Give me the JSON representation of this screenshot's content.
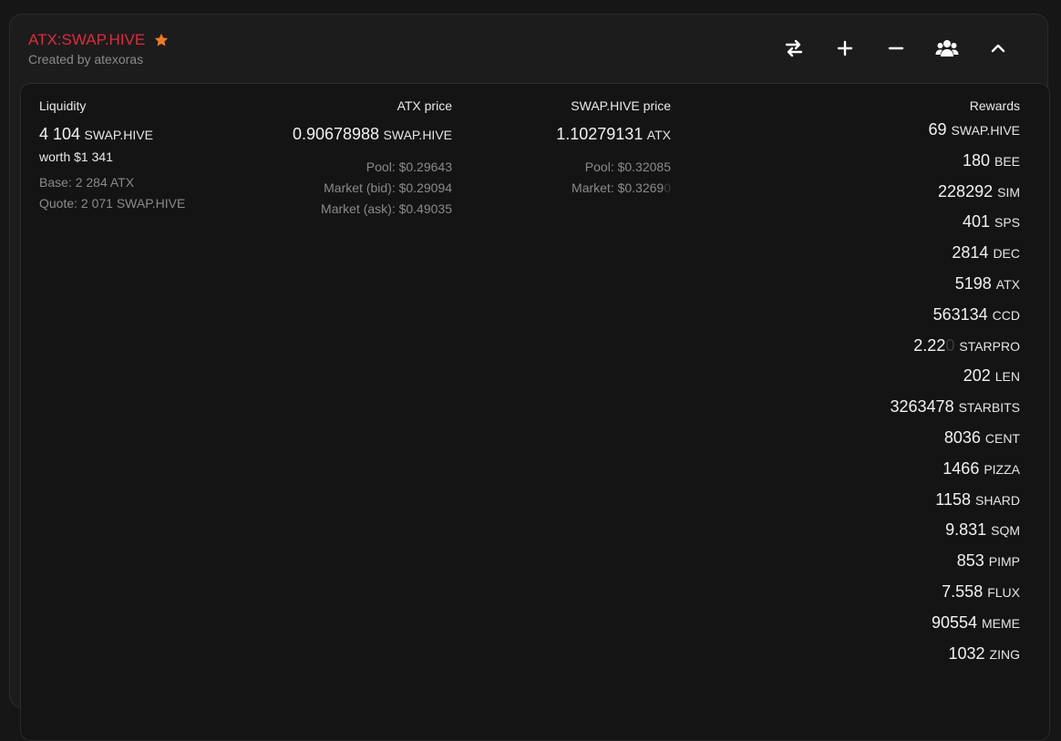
{
  "header": {
    "title": "ATX:SWAP.HIVE",
    "subtitle": "Created by atexoras"
  },
  "actions": [
    {
      "icon": "swap-arrows-icon"
    },
    {
      "icon": "plus-icon"
    },
    {
      "icon": "minus-icon"
    },
    {
      "icon": "users-icon"
    },
    {
      "icon": "chevron-up-icon"
    }
  ],
  "colors": {
    "accent": "#e02a3e",
    "star": "#f07c22"
  },
  "liquidity": {
    "label": "Liquidity",
    "amount": "4 104",
    "unit": "SWAP.HIVE",
    "worth": "worth $1 341",
    "base": "Base: 2 284 ATX",
    "quote": "Quote: 2 071 SWAP.HIVE"
  },
  "atx_price": {
    "label": "ATX price",
    "value": "0.90678988",
    "unit": "SWAP.HIVE",
    "pool": "Pool: $0.29643",
    "market_bid": "Market (bid): $0.29094",
    "market_ask": "Market (ask): $0.49035"
  },
  "swap_price": {
    "label": "SWAP.HIVE price",
    "value": "1.10279131",
    "unit": "ATX",
    "pool": "Pool: $0.32085",
    "market_main": "Market: $0.3269",
    "market_faded": "0"
  },
  "rewards": {
    "label": "Rewards",
    "items": [
      {
        "amount": "69",
        "token": "SWAP.HIVE"
      },
      {
        "amount": "180",
        "token": "BEE"
      },
      {
        "amount": "228292",
        "token": "SIM"
      },
      {
        "amount": "401",
        "token": "SPS"
      },
      {
        "amount": "2814",
        "token": "DEC"
      },
      {
        "amount": "5198",
        "token": "ATX"
      },
      {
        "amount": "563134",
        "token": "CCD"
      },
      {
        "amount": "2.22",
        "faded": "0",
        "token": "STARPRO"
      },
      {
        "amount": "202",
        "token": "LEN"
      },
      {
        "amount": "3263478",
        "token": "STARBITS"
      },
      {
        "amount": "8036",
        "token": "CENT"
      },
      {
        "amount": "1466",
        "token": "PIZZA"
      },
      {
        "amount": "1158",
        "token": "SHARD"
      },
      {
        "amount": "9.831",
        "token": "SQM"
      },
      {
        "amount": "853",
        "token": "PIMP"
      },
      {
        "amount": "7.558",
        "token": "FLUX"
      },
      {
        "amount": "90554",
        "token": "MEME"
      },
      {
        "amount": "1032",
        "token": "ZING"
      }
    ]
  }
}
